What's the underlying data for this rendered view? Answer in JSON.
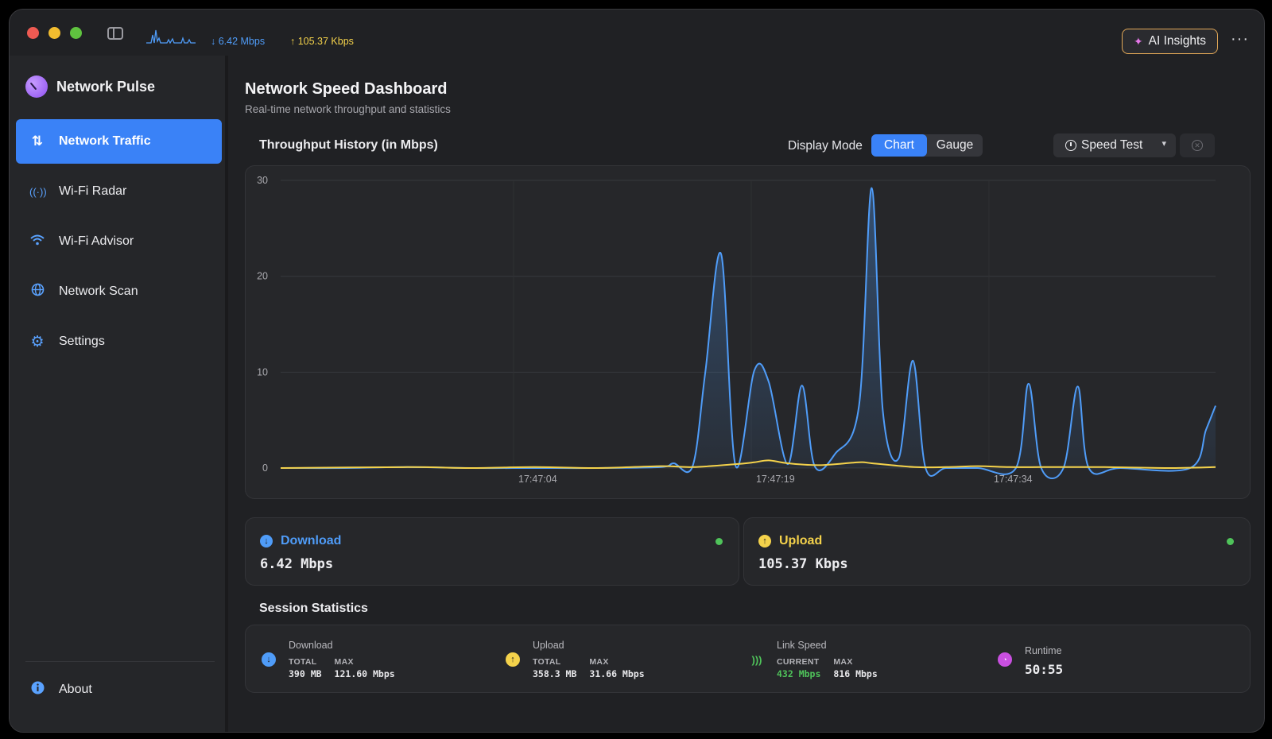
{
  "titlebar": {
    "download_rate": "↓ 6.42 Mbps",
    "upload_rate": "↑ 105.37 Kbps",
    "ai_insights_label": "AI Insights",
    "more_label": "···"
  },
  "sidebar": {
    "app_name": "Network Pulse",
    "items": [
      {
        "label": "Network Traffic",
        "icon": "arrows-up-down-icon",
        "active": true
      },
      {
        "label": "Wi-Fi Radar",
        "icon": "antenna-icon",
        "active": false
      },
      {
        "label": "Wi-Fi Advisor",
        "icon": "wifi-icon",
        "active": false
      },
      {
        "label": "Network Scan",
        "icon": "globe-icon",
        "active": false
      },
      {
        "label": "Settings",
        "icon": "gear-icon",
        "active": false
      }
    ],
    "about_label": "About"
  },
  "main": {
    "title": "Network Speed Dashboard",
    "subtitle": "Real-time network throughput and statistics",
    "throughput_title": "Throughput History (in Mbps)",
    "display_mode_label": "Display Mode",
    "modes": [
      "Chart",
      "Gauge"
    ],
    "selected_mode": "Chart",
    "speed_test_label": "Speed Test",
    "download_card": {
      "label": "Download",
      "value": "6.42 Mbps",
      "color": "#4f9cf8"
    },
    "upload_card": {
      "label": "Upload",
      "value": "105.37 Kbps",
      "color": "#f4d24b"
    },
    "session_title": "Session Statistics",
    "session": {
      "download": {
        "title": "Download",
        "total_key": "TOTAL",
        "total": "390 MB",
        "max_key": "MAX",
        "max": "121.60 Mbps"
      },
      "upload": {
        "title": "Upload",
        "total_key": "TOTAL",
        "total": "358.3 MB",
        "max_key": "MAX",
        "max": "31.66 Mbps"
      },
      "link": {
        "title": "Link Speed",
        "current_key": "CURRENT",
        "current": "432 Mbps",
        "max_key": "MAX",
        "max": "816 Mbps"
      },
      "runtime": {
        "title": "Runtime",
        "value": "50:55"
      }
    }
  },
  "colors": {
    "accent": "#3a82f7",
    "download": "#4f9cf8",
    "upload": "#f4d24b",
    "live": "#4fc35a",
    "runtime": "#c94fe0"
  },
  "chart_data": {
    "type": "area",
    "title": "Throughput History (in Mbps)",
    "xlabel": "",
    "ylabel": "",
    "ylim": [
      0,
      30
    ],
    "yticks": [
      0,
      10,
      20,
      30
    ],
    "x_ticks": [
      {
        "t": 14.7,
        "label": "17:47:04"
      },
      {
        "t": 29.7,
        "label": "17:47:19"
      },
      {
        "t": 44.7,
        "label": "17:47:34"
      }
    ],
    "xlim": [
      0,
      59
    ],
    "grid": true,
    "series": [
      {
        "key": "download",
        "color": "#4f9cf8",
        "points": [
          [
            0,
            0
          ],
          [
            4,
            0
          ],
          [
            8,
            0.1
          ],
          [
            12,
            0
          ],
          [
            16,
            0
          ],
          [
            20,
            0
          ],
          [
            24,
            0.1
          ],
          [
            24.8,
            0.5
          ],
          [
            26,
            0.2
          ],
          [
            26.8,
            10
          ],
          [
            27.8,
            22.3
          ],
          [
            28.7,
            0.3
          ],
          [
            29.9,
            10.2
          ],
          [
            30.8,
            9
          ],
          [
            32,
            0.4
          ],
          [
            32.9,
            8.6
          ],
          [
            33.7,
            0.2
          ],
          [
            35,
            1.5
          ],
          [
            36.5,
            6.5
          ],
          [
            37.3,
            29.2
          ],
          [
            38,
            6
          ],
          [
            39,
            1
          ],
          [
            39.9,
            11.2
          ],
          [
            40.7,
            0
          ],
          [
            42,
            0
          ],
          [
            44,
            0
          ],
          [
            46.4,
            0
          ],
          [
            47.2,
            8.8
          ],
          [
            48,
            0
          ],
          [
            49.4,
            0
          ],
          [
            50.3,
            8.5
          ],
          [
            51,
            0
          ],
          [
            53,
            0
          ],
          [
            57.4,
            0
          ],
          [
            58.4,
            4
          ],
          [
            59,
            6.5
          ]
        ]
      },
      {
        "key": "upload",
        "color": "#f4d24b",
        "points": [
          [
            0,
            0
          ],
          [
            8,
            0.1
          ],
          [
            12,
            0
          ],
          [
            16,
            0.1
          ],
          [
            20,
            0
          ],
          [
            24,
            0.2
          ],
          [
            26,
            0.1
          ],
          [
            28.7,
            0.4
          ],
          [
            29.9,
            0.6
          ],
          [
            30.8,
            0.8
          ],
          [
            32,
            0.5
          ],
          [
            34,
            0.3
          ],
          [
            36.5,
            0.6
          ],
          [
            37.3,
            0.5
          ],
          [
            40,
            0.1
          ],
          [
            42,
            0.1
          ],
          [
            44,
            0.2
          ],
          [
            46,
            0.1
          ],
          [
            48,
            0.1
          ],
          [
            50,
            0.1
          ],
          [
            52,
            0.1
          ],
          [
            56,
            0
          ],
          [
            59,
            0.1
          ]
        ]
      }
    ]
  }
}
